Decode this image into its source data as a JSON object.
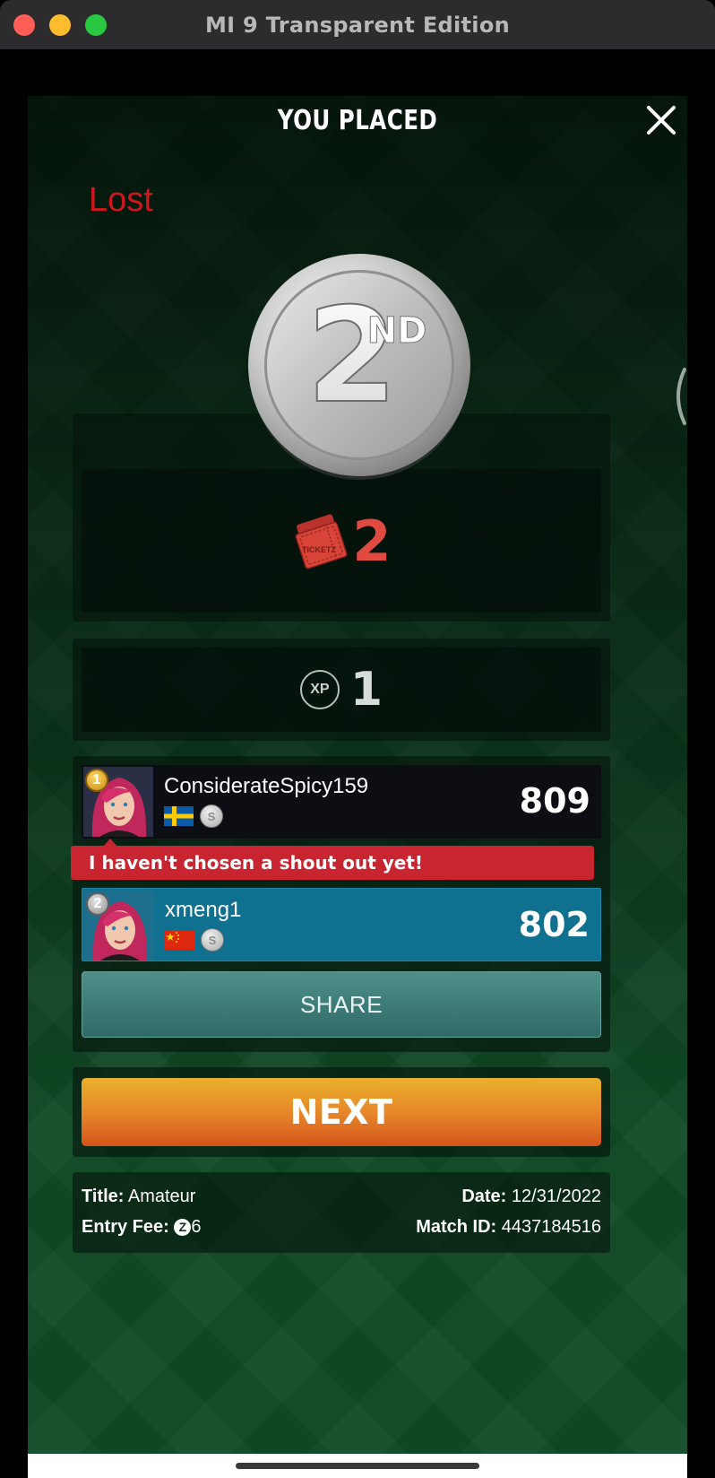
{
  "window": {
    "title": "MI 9 Transparent Edition"
  },
  "header": {
    "title": "YOU PLACED"
  },
  "status": {
    "text": "Lost"
  },
  "medal": {
    "number": "2",
    "suffix": "ND"
  },
  "reward": {
    "ticket_label": "TICKETZ",
    "ticket_count": "2"
  },
  "xp": {
    "badge": "XP",
    "value": "1"
  },
  "players": [
    {
      "rank": "1",
      "name": "ConsiderateSpicy159",
      "country": "Sweden",
      "score": "809",
      "coin": "S"
    },
    {
      "rank": "2",
      "name": "xmeng1",
      "country": "China",
      "score": "802",
      "coin": "S"
    }
  ],
  "shout_out": "I haven't chosen a shout out yet!",
  "buttons": {
    "share": "SHARE",
    "next": "NEXT"
  },
  "match_info": {
    "title_label": "Title:",
    "title_value": "Amateur",
    "fee_label": "Entry Fee:",
    "fee_coin": "Z",
    "fee_value": "6",
    "date_label": "Date:",
    "date_value": "12/31/2022",
    "match_id_label": "Match ID:",
    "match_id_value": "4437184516"
  },
  "colors": {
    "lost_red": "#d0161d",
    "ticket_red": "#e04a40",
    "shout_red": "#c82530",
    "player_highlight": "#10708f",
    "next_button_top": "#e9b12c",
    "next_button_bottom": "#d4541b",
    "share_button": "#3f7c78"
  },
  "icons": [
    "close-icon",
    "ticket-icon",
    "xp-icon",
    "coin-icon",
    "sweden-flag",
    "china-flag",
    "silver-medal"
  ]
}
